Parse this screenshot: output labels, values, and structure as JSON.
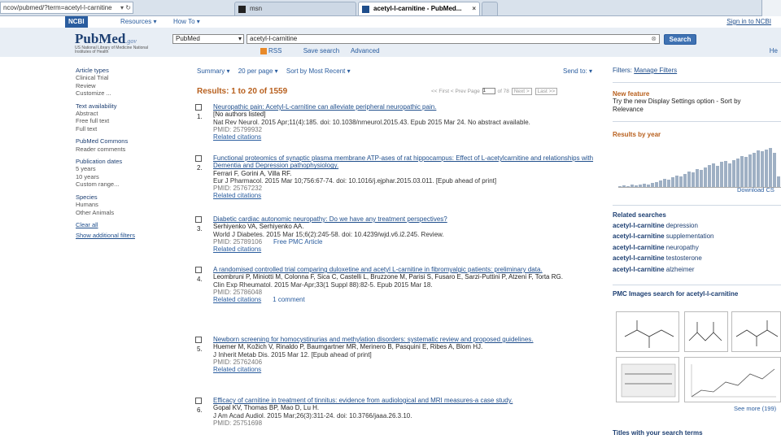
{
  "browser": {
    "url": "ncov/pubmed/?term=acetyl-l-carnitine",
    "tabs": [
      {
        "label": "msn"
      },
      {
        "label": "acetyl-l-carnitine - PubMed..."
      }
    ]
  },
  "ncbi": {
    "logo": "NCBI",
    "resources": "Resources ▾",
    "howto": "How To ▾",
    "signin": "Sign in to NCBI"
  },
  "header": {
    "logo": "PubMed",
    "logo_gov": ".gov",
    "logo_sub": "US National Library of Medicine National Institutes of Health",
    "db": "PubMed",
    "query": "acetyl-l-carnitine",
    "search_button": "Search",
    "rss": "RSS",
    "save_search": "Save search",
    "advanced": "Advanced",
    "help": "He"
  },
  "filters": {
    "groups": [
      {
        "heading": "Article types",
        "items": [
          "Clinical Trial",
          "Review",
          "Customize ..."
        ]
      },
      {
        "heading": "Text availability",
        "items": [
          "Abstract",
          "Free full text",
          "Full text"
        ]
      },
      {
        "heading": "PubMed Commons",
        "items": [
          "Reader comments"
        ]
      },
      {
        "heading": "Publication dates",
        "items": [
          "5 years",
          "10 years",
          "Custom range..."
        ]
      },
      {
        "heading": "Species",
        "items": [
          "Humans",
          "Other Animals"
        ]
      }
    ],
    "clear_all": "Clear all",
    "show_additional": "Show additional filters"
  },
  "toolbar": {
    "summary": "Summary ▾",
    "per_page": "20 per page ▾",
    "sort": "Sort by Most Recent ▾",
    "send_to": "Send to: ▾"
  },
  "results": {
    "heading": "Results: 1 to 20 of 1559",
    "pager": {
      "first": "<< First",
      "prev": "< Prev",
      "page_label": "Page",
      "page_value": "1",
      "of": "of 78",
      "next": "Next >",
      "last": "Last >>"
    },
    "items": [
      {
        "num": "1.",
        "title": "Neuropathic pain: Acetyl-L-carnitine can alleviate peripheral neuropathic pain.",
        "authors": "[No authors listed]",
        "citation": "Nat Rev Neurol. 2015 Apr;11(4):185. doi: 10.1038/nrneurol.2015.43. Epub 2015 Mar 24. No abstract available.",
        "pmid": "PMID: 25799932",
        "related": "Related citations",
        "extra": ""
      },
      {
        "num": "2.",
        "title": "Functional proteomics of synaptic plasma membrane ATP-ases of rat hippocampus: Effect of L-acetylcarnitine and relationships with Dementia and Depression pathophysiology.",
        "authors": "Ferrari F, Gorini A, Villa RF.",
        "citation": "Eur J Pharmacol. 2015 Mar 10;756:67-74. doi: 10.1016/j.ejphar.2015.03.011. [Epub ahead of print]",
        "pmid": "PMID: 25767232",
        "related": "Related citations",
        "extra": ""
      },
      {
        "num": "3.",
        "title": "Diabetic cardiac autonomic neuropathy: Do we have any treatment perspectives?",
        "authors": "Serhiyenko VA, Serhiyenko AA.",
        "citation": "World J Diabetes. 2015 Mar 15;6(2):245-58. doi: 10.4239/wjd.v6.i2.245. Review.",
        "pmid": "PMID: 25789106",
        "related": "Related citations",
        "extra": "Free PMC Article"
      },
      {
        "num": "4.",
        "title": "A randomised controlled trial comparing duloxetine and acetyl L-carnitine in fibromyalgic patients: preliminary data.",
        "authors": "Leombruni P, Miniotti M, Colonna F, Sica C, Castelli L, Bruzzone M, Parisi S, Fusaro E, Sarzi-Puttini P, Atzeni F, Torta RG.",
        "citation": "Clin Exp Rheumatol. 2015 Mar-Apr;33(1 Suppl 88):82-5. Epub 2015 Mar 18.",
        "pmid": "PMID: 25786048",
        "related": "Related citations",
        "extra": "1 comment"
      },
      {
        "num": "5.",
        "title": "Newborn screening for homocystinurias and methylation disorders: systematic review and proposed guidelines.",
        "authors": "Huemer M, Kožich V, Rinaldo P, Baumgartner MR, Merinero B, Pasquini E, Ribes A, Blom HJ.",
        "citation": "J Inherit Metab Dis. 2015 Mar 12. [Epub ahead of print]",
        "pmid": "PMID: 25762406",
        "related": "Related citations",
        "extra": ""
      },
      {
        "num": "6.",
        "title": "Efficacy of carnitine in treatment of tinnitus: evidence from audiological and MRI measures-a case study.",
        "authors": "Gopal KV, Thomas BP, Mao D, Lu H.",
        "citation": "J Am Acad Audiol. 2015 Mar;26(3):311-24. doi: 10.3766/jaaa.26.3.10.",
        "pmid": "PMID: 25751698",
        "related": "",
        "extra": ""
      }
    ]
  },
  "right": {
    "filters_label": "Filters:",
    "manage_filters": "Manage Filters",
    "new_feature_h": "New feature",
    "new_feature_text": "Try the new Display Settings option - Sort by Relevance",
    "results_by_year_h": "Results by year",
    "year_counts": [
      2,
      3,
      2,
      4,
      3,
      5,
      6,
      4,
      8,
      10,
      12,
      15,
      14,
      18,
      22,
      20,
      25,
      30,
      28,
      35,
      33,
      38,
      42,
      45,
      40,
      48,
      50,
      46,
      52,
      55,
      60,
      58,
      62,
      65,
      70,
      68,
      72,
      75,
      66,
      20
    ],
    "download": "Download CS",
    "related_h": "Related searches",
    "related": [
      {
        "bold": "acetyl-l-carnitine",
        "rest": " depression"
      },
      {
        "bold": "acetyl-l-carnitine",
        "rest": " supplementation"
      },
      {
        "bold": "acetyl-l-carnitine",
        "rest": " neuropathy"
      },
      {
        "bold": "acetyl-l-carnitine",
        "rest": " testosterone"
      },
      {
        "bold": "acetyl-l-carnitine",
        "rest": " alzheimer"
      }
    ],
    "pmc_h": "PMC Images search for acetyl-l-carnitine",
    "see_more": "See more (199)",
    "titles_h": "Titles with your search terms"
  },
  "colors": {
    "ncbi_blue": "#2a5d9f",
    "link_blue": "#1f4e8c",
    "result_orange": "#b8601e",
    "header_bg": "#e8eef5"
  }
}
